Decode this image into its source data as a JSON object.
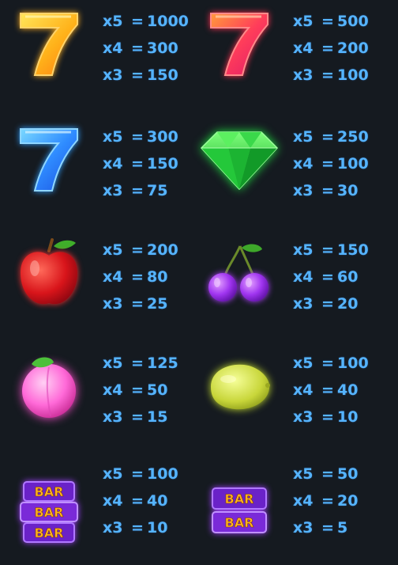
{
  "paytable": {
    "accent_color": "#55b4ff",
    "background_color": "#151a20",
    "symbols": [
      {
        "icon": "gold-seven-icon",
        "color": "#f5a623",
        "pays": [
          {
            "count": "x5",
            "value": "1000"
          },
          {
            "count": "x4",
            "value": "300"
          },
          {
            "count": "x3",
            "value": "150"
          }
        ]
      },
      {
        "icon": "red-seven-icon",
        "color": "#ff3b5c",
        "pays": [
          {
            "count": "x5",
            "value": "500"
          },
          {
            "count": "x4",
            "value": "200"
          },
          {
            "count": "x3",
            "value": "100"
          }
        ]
      },
      {
        "icon": "blue-seven-icon",
        "color": "#2f8cff",
        "pays": [
          {
            "count": "x5",
            "value": "300"
          },
          {
            "count": "x4",
            "value": "150"
          },
          {
            "count": "x3",
            "value": "75"
          }
        ]
      },
      {
        "icon": "green-diamond-icon",
        "color": "#22d43a",
        "pays": [
          {
            "count": "x5",
            "value": "250"
          },
          {
            "count": "x4",
            "value": "100"
          },
          {
            "count": "x3",
            "value": "30"
          }
        ]
      },
      {
        "icon": "apple-icon",
        "color": "#e0201e",
        "pays": [
          {
            "count": "x5",
            "value": "200"
          },
          {
            "count": "x4",
            "value": "80"
          },
          {
            "count": "x3",
            "value": "25"
          }
        ]
      },
      {
        "icon": "cherries-icon",
        "color": "#a53cf0",
        "pays": [
          {
            "count": "x5",
            "value": "150"
          },
          {
            "count": "x4",
            "value": "60"
          },
          {
            "count": "x3",
            "value": "20"
          }
        ]
      },
      {
        "icon": "peach-icon",
        "color": "#ff5fd0",
        "pays": [
          {
            "count": "x5",
            "value": "125"
          },
          {
            "count": "x4",
            "value": "50"
          },
          {
            "count": "x3",
            "value": "15"
          }
        ]
      },
      {
        "icon": "lemon-icon",
        "color": "#c8d83a",
        "pays": [
          {
            "count": "x5",
            "value": "100"
          },
          {
            "count": "x4",
            "value": "40"
          },
          {
            "count": "x3",
            "value": "10"
          }
        ]
      },
      {
        "icon": "triple-bar-icon",
        "color": "#8a3cf0",
        "label": "BAR",
        "pays": [
          {
            "count": "x5",
            "value": "100"
          },
          {
            "count": "x4",
            "value": "40"
          },
          {
            "count": "x3",
            "value": "10"
          }
        ]
      },
      {
        "icon": "double-bar-icon",
        "color": "#8a3cf0",
        "label": "BAR",
        "pays": [
          {
            "count": "x5",
            "value": "50"
          },
          {
            "count": "x4",
            "value": "20"
          },
          {
            "count": "x3",
            "value": "5"
          }
        ]
      }
    ]
  }
}
